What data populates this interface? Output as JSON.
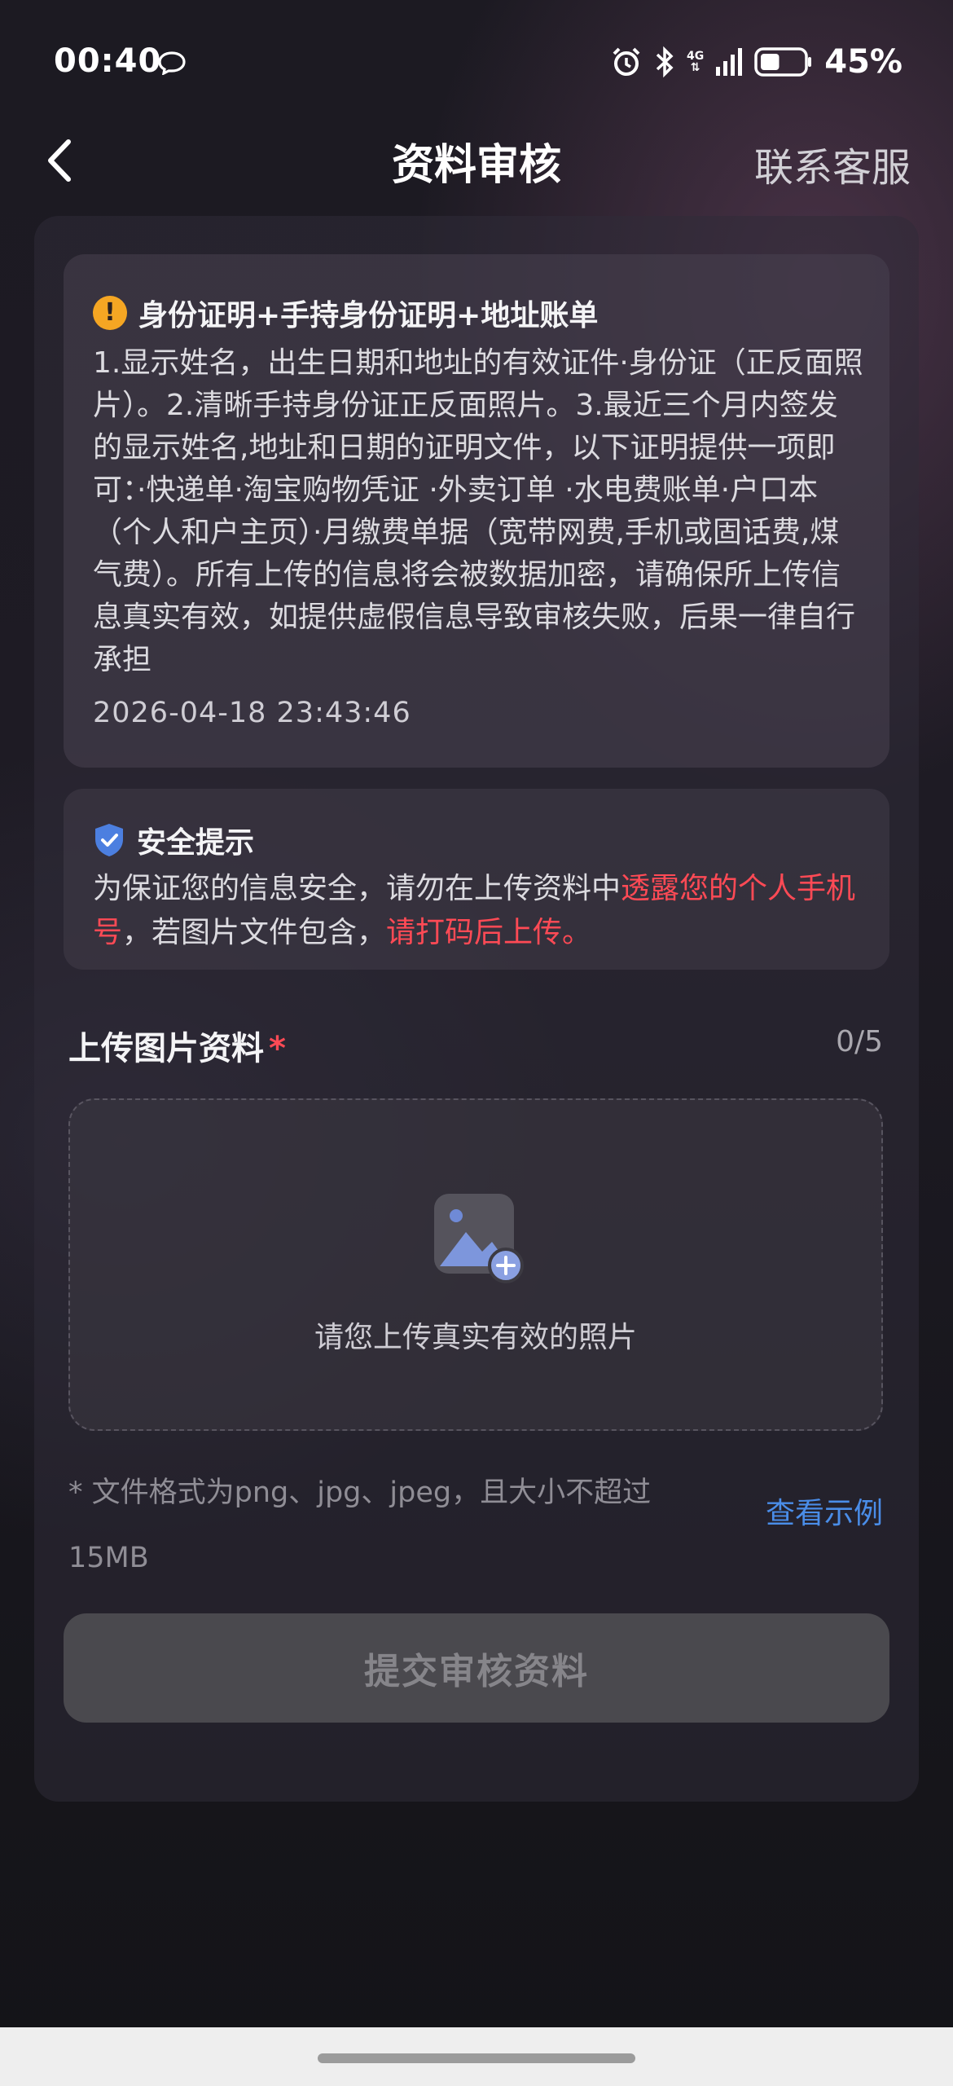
{
  "status_bar": {
    "time": "00:40",
    "network": "4G",
    "battery_percent": "45%",
    "battery_level": 0.45,
    "icons": [
      "chat-bubble-icon",
      "alarm-icon",
      "bluetooth-icon",
      "signal-icon",
      "battery-icon"
    ]
  },
  "header": {
    "title": "资料审核",
    "support_label": "联系客服",
    "back_icon": "back-chevron-icon"
  },
  "requirements": {
    "title": "身份证明+手持身份证明+地址账单",
    "body": "1.显示姓名，出生日期和地址的有效证件·身份证（正反面照片）。2.清晰手持身份证正反面照片。3.最近三个月内签发的显示姓名,地址和日期的证明文件，以下证明提供一项即可：·快递单·淘宝购物凭证 ·外卖订单 ·水电费账单·户口本（个人和户主页）·月缴费单据（宽带网费,手机或固话费,煤气费）。所有上传的信息将会被数据加密，请确保所上传信息真实有效，如提供虚假信息导致审核失败，后果一律自行承担",
    "date": "2026-04-18 23:43:46"
  },
  "safety": {
    "title": "安全提示",
    "text_1": "为保证您的信息安全，请勿在上传资料中",
    "highlight_1": "透露您的个人手机号",
    "text_2": "，若图片文件包含，",
    "highlight_2": "请打码后上传。"
  },
  "upload": {
    "label": "上传图片资料",
    "required_mark": "*",
    "count": "0/5",
    "hint": "请您上传真实有效的照片",
    "format_note": "* 文件格式为png、jpg、jpeg，且大小不超过15MB",
    "example_link": "查看示例"
  },
  "submit_label": "提交审核资料",
  "colors": {
    "accent_red": "#ff4a55",
    "link_blue": "#4a8de8",
    "warning_orange": "#f5a623",
    "shield_blue": "#4c7fe0"
  }
}
